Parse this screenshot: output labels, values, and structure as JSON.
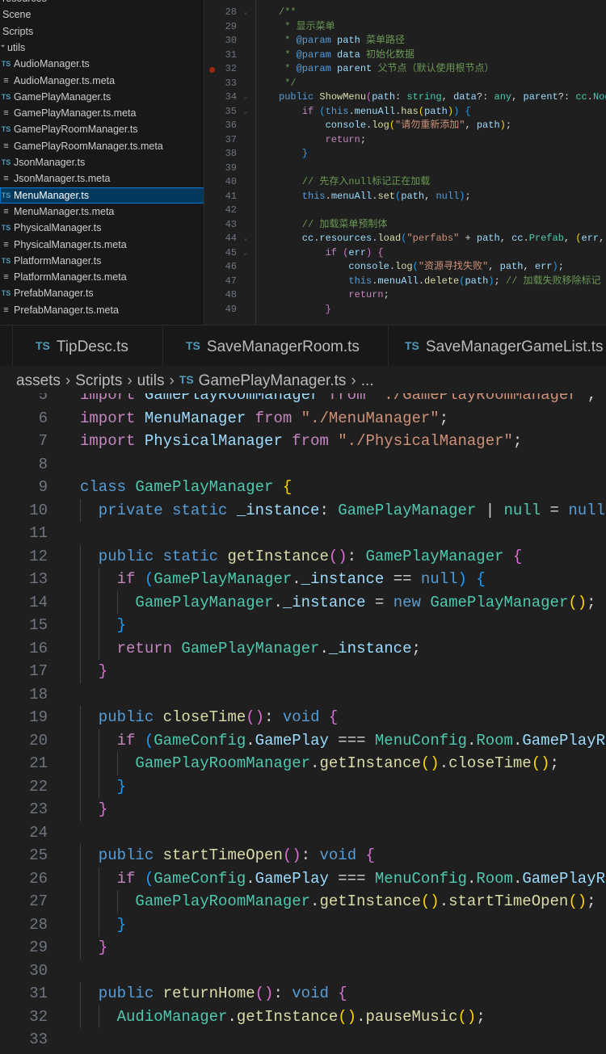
{
  "explorer": {
    "items": [
      {
        "label": "resources",
        "type": "folder"
      },
      {
        "label": "Scene",
        "type": "folder"
      },
      {
        "label": "Scripts",
        "type": "folder"
      },
      {
        "label": "utils",
        "type": "folder-open"
      },
      {
        "label": "AudioManager.ts",
        "type": "ts"
      },
      {
        "label": "AudioManager.ts.meta",
        "type": "meta"
      },
      {
        "label": "GamePlayManager.ts",
        "type": "ts"
      },
      {
        "label": "GamePlayManager.ts.meta",
        "type": "meta"
      },
      {
        "label": "GamePlayRoomManager.ts",
        "type": "ts"
      },
      {
        "label": "GamePlayRoomManager.ts.meta",
        "type": "meta"
      },
      {
        "label": "JsonManager.ts",
        "type": "ts"
      },
      {
        "label": "JsonManager.ts.meta",
        "type": "meta"
      },
      {
        "label": "MenuManager.ts",
        "type": "ts",
        "selected": true
      },
      {
        "label": "MenuManager.ts.meta",
        "type": "meta"
      },
      {
        "label": "PhysicalManager.ts",
        "type": "ts"
      },
      {
        "label": "PhysicalManager.ts.meta",
        "type": "meta"
      },
      {
        "label": "PlatformManager.ts",
        "type": "ts"
      },
      {
        "label": "PlatformManager.ts.meta",
        "type": "meta"
      },
      {
        "label": "PrefabManager.ts",
        "type": "ts"
      },
      {
        "label": "PrefabManager.ts.meta",
        "type": "meta"
      }
    ],
    "ts_icon": "TS",
    "meta_icon": "≡"
  },
  "top_code": [
    {
      "n": 28,
      "fold": true,
      "t": [
        [
          "/**",
          "m"
        ]
      ]
    },
    {
      "n": 29,
      "t": [
        [
          " * 显示菜单",
          "m"
        ]
      ]
    },
    {
      "n": 30,
      "t": [
        [
          " * ",
          "m"
        ],
        [
          "@param",
          "k"
        ],
        [
          " path",
          "v"
        ],
        [
          " 菜单路径",
          "m"
        ]
      ]
    },
    {
      "n": 31,
      "t": [
        [
          " * ",
          "m"
        ],
        [
          "@param",
          "k"
        ],
        [
          " data",
          "v"
        ],
        [
          " 初始化数据",
          "m"
        ]
      ]
    },
    {
      "n": 32,
      "bp": true,
      "t": [
        [
          " * ",
          "m"
        ],
        [
          "@param",
          "k"
        ],
        [
          " parent",
          "v"
        ],
        [
          " 父节点（默认使用根节点）",
          "m"
        ]
      ]
    },
    {
      "n": 33,
      "t": [
        [
          " */",
          "m"
        ]
      ]
    },
    {
      "n": 34,
      "fold": true,
      "t": [
        [
          "public ",
          "k"
        ],
        [
          "ShowMenu",
          "f"
        ],
        [
          "(",
          "b2"
        ],
        [
          "path",
          "v"
        ],
        [
          ": ",
          "p"
        ],
        [
          "string",
          "t"
        ],
        [
          ", ",
          "p"
        ],
        [
          "data",
          "v"
        ],
        [
          "?: ",
          "p"
        ],
        [
          "any",
          "t"
        ],
        [
          ", ",
          "p"
        ],
        [
          "parent",
          "v"
        ],
        [
          "?: ",
          "p"
        ],
        [
          "cc",
          "t"
        ],
        [
          ".",
          "p"
        ],
        [
          "Nod",
          "t"
        ]
      ]
    },
    {
      "n": 35,
      "fold": true,
      "t": [
        [
          "    if ",
          "c"
        ],
        [
          "(",
          "b3"
        ],
        [
          "this",
          "k"
        ],
        [
          ".",
          "p"
        ],
        [
          "menuAll",
          "v"
        ],
        [
          ".",
          "p"
        ],
        [
          "has",
          "f"
        ],
        [
          "(",
          "b1"
        ],
        [
          "path",
          "v"
        ],
        [
          ")",
          "b1"
        ],
        [
          ")",
          "b3"
        ],
        [
          " {",
          "b3"
        ]
      ]
    },
    {
      "n": 36,
      "t": [
        [
          "        console",
          "v"
        ],
        [
          ".",
          "p"
        ],
        [
          "log",
          "f"
        ],
        [
          "(",
          "b1"
        ],
        [
          "\"请勿重新添加\"",
          "s"
        ],
        [
          ", ",
          "p"
        ],
        [
          "path",
          "v"
        ],
        [
          ")",
          "b1"
        ],
        [
          ";",
          "p"
        ]
      ]
    },
    {
      "n": 37,
      "t": [
        [
          "        return",
          "c"
        ],
        [
          ";",
          "p"
        ]
      ]
    },
    {
      "n": 38,
      "t": [
        [
          "    }",
          "b3"
        ]
      ]
    },
    {
      "n": 39,
      "t": []
    },
    {
      "n": 40,
      "t": [
        [
          "    // 先存入null标记正在加载",
          "m"
        ]
      ]
    },
    {
      "n": 41,
      "t": [
        [
          "    this",
          "k"
        ],
        [
          ".",
          "p"
        ],
        [
          "menuAll",
          "v"
        ],
        [
          ".",
          "p"
        ],
        [
          "set",
          "f"
        ],
        [
          "(",
          "b3"
        ],
        [
          "path",
          "v"
        ],
        [
          ", ",
          "p"
        ],
        [
          "null",
          "k"
        ],
        [
          ")",
          "b3"
        ],
        [
          ";",
          "p"
        ]
      ]
    },
    {
      "n": 42,
      "t": []
    },
    {
      "n": 43,
      "t": [
        [
          "    // 加载菜单预制体",
          "m"
        ]
      ]
    },
    {
      "n": 44,
      "fold": true,
      "t": [
        [
          "    cc",
          "v"
        ],
        [
          ".",
          "p"
        ],
        [
          "resources",
          "v"
        ],
        [
          ".",
          "p"
        ],
        [
          "load",
          "f"
        ],
        [
          "(",
          "b3"
        ],
        [
          "\"perfabs\"",
          "s"
        ],
        [
          " + ",
          "p"
        ],
        [
          "path",
          "v"
        ],
        [
          ", ",
          "p"
        ],
        [
          "cc",
          "v"
        ],
        [
          ".",
          "p"
        ],
        [
          "Prefab",
          "t"
        ],
        [
          ", ",
          "p"
        ],
        [
          "(",
          "b1"
        ],
        [
          "err",
          "v"
        ],
        [
          ", ",
          "p"
        ]
      ]
    },
    {
      "n": 45,
      "fold": true,
      "t": [
        [
          "        if ",
          "c"
        ],
        [
          "(",
          "b2"
        ],
        [
          "err",
          "v"
        ],
        [
          ")",
          "b2"
        ],
        [
          " {",
          "b2"
        ]
      ]
    },
    {
      "n": 46,
      "t": [
        [
          "            console",
          "v"
        ],
        [
          ".",
          "p"
        ],
        [
          "log",
          "f"
        ],
        [
          "(",
          "b3"
        ],
        [
          "\"资源寻找失败\"",
          "s"
        ],
        [
          ", ",
          "p"
        ],
        [
          "path",
          "v"
        ],
        [
          ", ",
          "p"
        ],
        [
          "err",
          "v"
        ],
        [
          ")",
          "b3"
        ],
        [
          ";",
          "p"
        ]
      ]
    },
    {
      "n": 47,
      "t": [
        [
          "            this",
          "k"
        ],
        [
          ".",
          "p"
        ],
        [
          "menuAll",
          "v"
        ],
        [
          ".",
          "p"
        ],
        [
          "delete",
          "f"
        ],
        [
          "(",
          "b3"
        ],
        [
          "path",
          "v"
        ],
        [
          ")",
          "b3"
        ],
        [
          "; ",
          "p"
        ],
        [
          "// 加载失败移除标记",
          "m"
        ]
      ]
    },
    {
      "n": 48,
      "t": [
        [
          "            return",
          "c"
        ],
        [
          ";",
          "p"
        ]
      ]
    },
    {
      "n": 49,
      "t": [
        [
          "        }",
          "b2"
        ]
      ]
    }
  ],
  "tabs": [
    {
      "icon": "TS",
      "label": "TipDesc.ts"
    },
    {
      "icon": "TS",
      "label": "SaveManagerRoom.ts"
    },
    {
      "icon": "TS",
      "label": "SaveManagerGameList.ts"
    }
  ],
  "breadcrumb": {
    "items": [
      "assets",
      "Scripts",
      "utils"
    ],
    "file_icon": "TS",
    "file": "GamePlayManager.ts",
    "separator": "›",
    "more": "..."
  },
  "main_code": [
    {
      "n": 5,
      "t": [
        [
          "import ",
          "c"
        ],
        [
          "GamePlayRoomManager ",
          "v"
        ],
        [
          "from ",
          "c"
        ],
        [
          "\"./GamePlayRoomManager\"",
          "s"
        ],
        [
          ";",
          "p"
        ]
      ]
    },
    {
      "n": 6,
      "t": [
        [
          "import ",
          "c"
        ],
        [
          "MenuManager ",
          "v"
        ],
        [
          "from ",
          "c"
        ],
        [
          "\"./MenuManager\"",
          "s"
        ],
        [
          ";",
          "p"
        ]
      ]
    },
    {
      "n": 7,
      "t": [
        [
          "import ",
          "c"
        ],
        [
          "PhysicalManager ",
          "v"
        ],
        [
          "from ",
          "c"
        ],
        [
          "\"./PhysicalManager\"",
          "s"
        ],
        [
          ";",
          "p"
        ]
      ]
    },
    {
      "n": 8,
      "t": []
    },
    {
      "n": 9,
      "t": [
        [
          "class ",
          "k"
        ],
        [
          "GamePlayManager ",
          "t"
        ],
        [
          "{",
          "b1"
        ]
      ]
    },
    {
      "n": 10,
      "t": [
        [
          "  private static ",
          "k"
        ],
        [
          "_instance",
          "v"
        ],
        [
          ": ",
          "p"
        ],
        [
          "GamePlayManager",
          "t"
        ],
        [
          " | ",
          "p"
        ],
        [
          "null",
          "t"
        ],
        [
          " = ",
          "p"
        ],
        [
          "null",
          "k"
        ]
      ]
    },
    {
      "n": 11,
      "t": []
    },
    {
      "n": 12,
      "t": [
        [
          "  public static ",
          "k"
        ],
        [
          "getInstance",
          "f"
        ],
        [
          "()",
          "b2"
        ],
        [
          ": ",
          "p"
        ],
        [
          "GamePlayManager ",
          "t"
        ],
        [
          "{",
          "b2"
        ]
      ]
    },
    {
      "n": 13,
      "t": [
        [
          "    if ",
          "c"
        ],
        [
          "(",
          "b3"
        ],
        [
          "GamePlayManager",
          "t"
        ],
        [
          ".",
          "p"
        ],
        [
          "_instance",
          "v"
        ],
        [
          " == ",
          "p"
        ],
        [
          "null",
          "k"
        ],
        [
          ")",
          "b3"
        ],
        [
          " {",
          "b3"
        ]
      ]
    },
    {
      "n": 14,
      "t": [
        [
          "      GamePlayManager",
          "t"
        ],
        [
          ".",
          "p"
        ],
        [
          "_instance",
          "v"
        ],
        [
          " = ",
          "p"
        ],
        [
          "new ",
          "k"
        ],
        [
          "GamePlayManager",
          "t"
        ],
        [
          "()",
          "b1"
        ],
        [
          ";",
          "p"
        ]
      ]
    },
    {
      "n": 15,
      "t": [
        [
          "    }",
          "b3"
        ]
      ]
    },
    {
      "n": 16,
      "t": [
        [
          "    return ",
          "c"
        ],
        [
          "GamePlayManager",
          "t"
        ],
        [
          ".",
          "p"
        ],
        [
          "_instance",
          "v"
        ],
        [
          ";",
          "p"
        ]
      ]
    },
    {
      "n": 17,
      "t": [
        [
          "  }",
          "b2"
        ]
      ]
    },
    {
      "n": 18,
      "t": []
    },
    {
      "n": 19,
      "t": [
        [
          "  public ",
          "k"
        ],
        [
          "closeTime",
          "f"
        ],
        [
          "()",
          "b2"
        ],
        [
          ": ",
          "p"
        ],
        [
          "void ",
          "k"
        ],
        [
          "{",
          "b2"
        ]
      ]
    },
    {
      "n": 20,
      "t": [
        [
          "    if ",
          "c"
        ],
        [
          "(",
          "b3"
        ],
        [
          "GameConfig",
          "t"
        ],
        [
          ".",
          "p"
        ],
        [
          "GamePlay",
          "v"
        ],
        [
          " === ",
          "p"
        ],
        [
          "MenuConfig",
          "t"
        ],
        [
          ".",
          "p"
        ],
        [
          "Room",
          "t"
        ],
        [
          ".",
          "p"
        ],
        [
          "GamePlayR",
          "v"
        ]
      ]
    },
    {
      "n": 21,
      "t": [
        [
          "      GamePlayRoomManager",
          "t"
        ],
        [
          ".",
          "p"
        ],
        [
          "getInstance",
          "f"
        ],
        [
          "()",
          "b1"
        ],
        [
          ".",
          "p"
        ],
        [
          "closeTime",
          "f"
        ],
        [
          "()",
          "b1"
        ],
        [
          ";",
          "p"
        ]
      ]
    },
    {
      "n": 22,
      "t": [
        [
          "    }",
          "b3"
        ]
      ]
    },
    {
      "n": 23,
      "t": [
        [
          "  }",
          "b2"
        ]
      ]
    },
    {
      "n": 24,
      "t": []
    },
    {
      "n": 25,
      "t": [
        [
          "  public ",
          "k"
        ],
        [
          "startTimeOpen",
          "f"
        ],
        [
          "()",
          "b2"
        ],
        [
          ": ",
          "p"
        ],
        [
          "void ",
          "k"
        ],
        [
          "{",
          "b2"
        ]
      ]
    },
    {
      "n": 26,
      "t": [
        [
          "    if ",
          "c"
        ],
        [
          "(",
          "b3"
        ],
        [
          "GameConfig",
          "t"
        ],
        [
          ".",
          "p"
        ],
        [
          "GamePlay",
          "v"
        ],
        [
          " === ",
          "p"
        ],
        [
          "MenuConfig",
          "t"
        ],
        [
          ".",
          "p"
        ],
        [
          "Room",
          "t"
        ],
        [
          ".",
          "p"
        ],
        [
          "GamePlayR",
          "v"
        ]
      ]
    },
    {
      "n": 27,
      "t": [
        [
          "      GamePlayRoomManager",
          "t"
        ],
        [
          ".",
          "p"
        ],
        [
          "getInstance",
          "f"
        ],
        [
          "()",
          "b1"
        ],
        [
          ".",
          "p"
        ],
        [
          "startTimeOpen",
          "f"
        ],
        [
          "()",
          "b1"
        ],
        [
          ";",
          "p"
        ]
      ]
    },
    {
      "n": 28,
      "t": [
        [
          "    }",
          "b3"
        ]
      ]
    },
    {
      "n": 29,
      "t": [
        [
          "  }",
          "b2"
        ]
      ]
    },
    {
      "n": 30,
      "t": []
    },
    {
      "n": 31,
      "t": [
        [
          "  public ",
          "k"
        ],
        [
          "returnHome",
          "f"
        ],
        [
          "()",
          "b2"
        ],
        [
          ": ",
          "p"
        ],
        [
          "void ",
          "k"
        ],
        [
          "{",
          "b2"
        ]
      ]
    },
    {
      "n": 32,
      "t": [
        [
          "    AudioManager",
          "t"
        ],
        [
          ".",
          "p"
        ],
        [
          "getInstance",
          "f"
        ],
        [
          "()",
          "b1"
        ],
        [
          ".",
          "p"
        ],
        [
          "pauseMusic",
          "f"
        ],
        [
          "()",
          "b1"
        ],
        [
          ";",
          "p"
        ]
      ]
    },
    {
      "n": 33,
      "t": []
    }
  ]
}
